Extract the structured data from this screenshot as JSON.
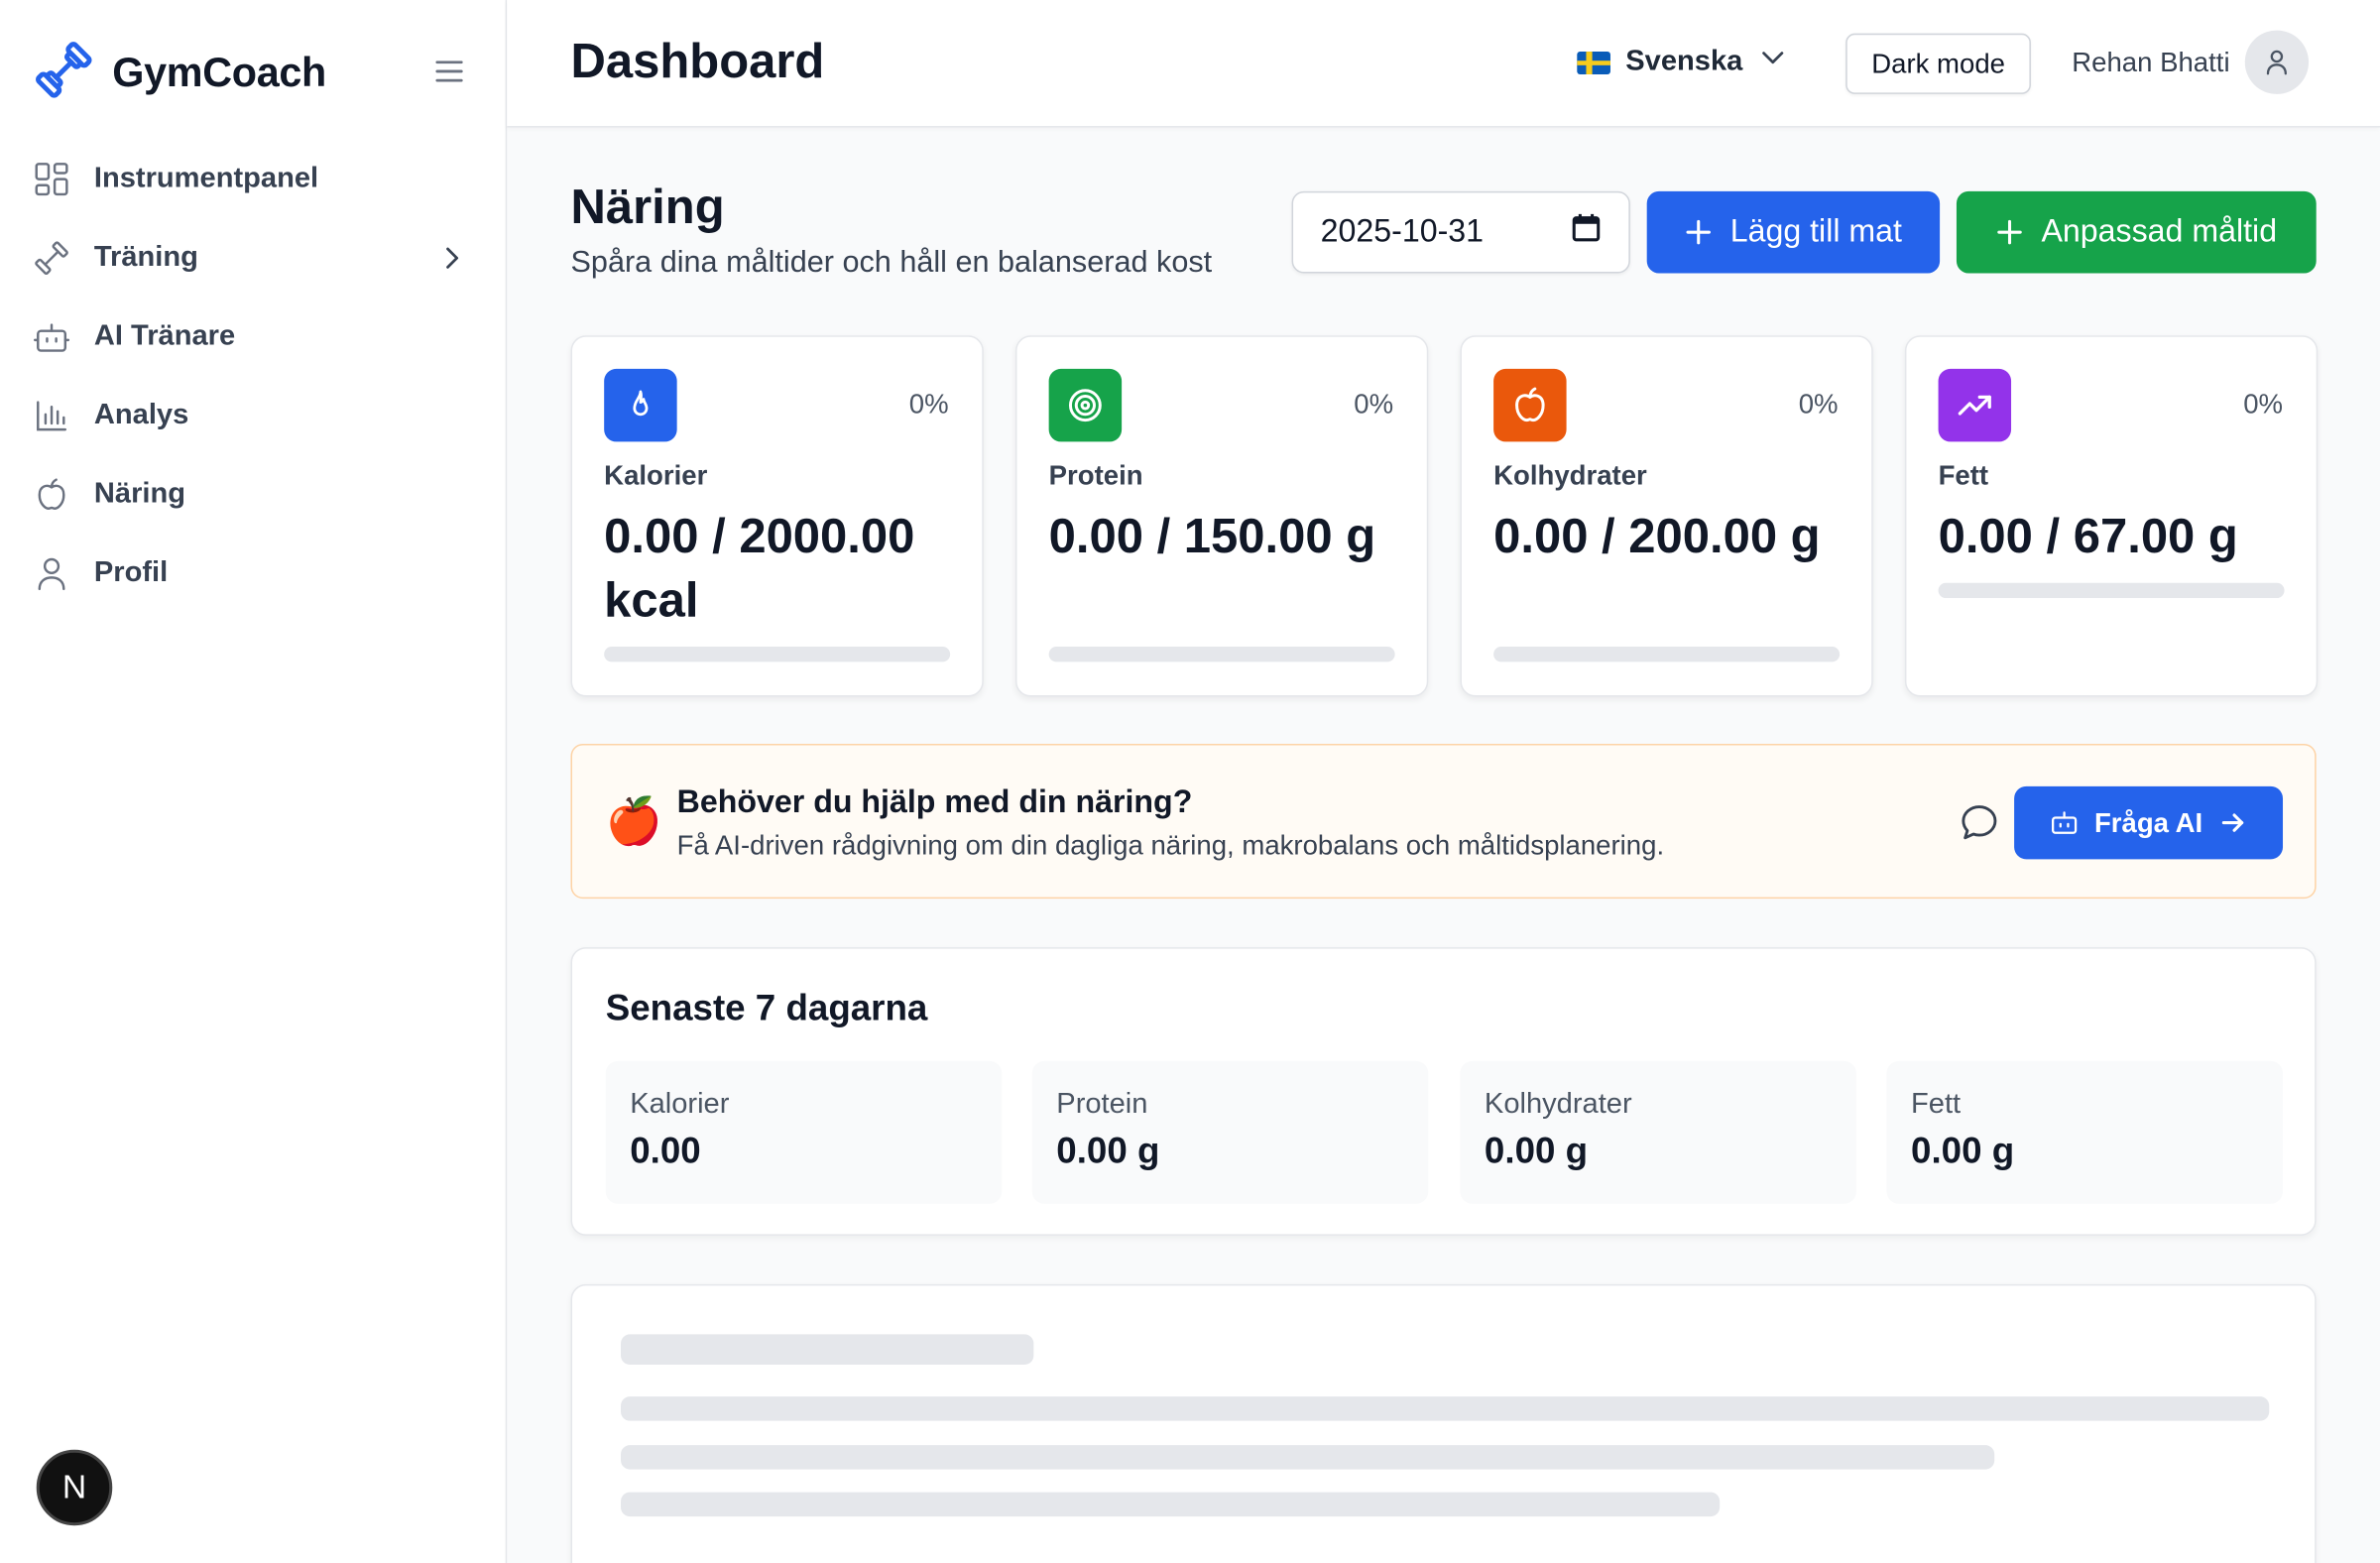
{
  "app": {
    "name": "GymCoach"
  },
  "sidebar": {
    "items": [
      {
        "label": "Instrumentpanel",
        "icon": "dashboard-grid-icon"
      },
      {
        "label": "Träning",
        "icon": "dumbbell-icon",
        "has_submenu": true
      },
      {
        "label": "AI Tränare",
        "icon": "robot-icon"
      },
      {
        "label": "Analys",
        "icon": "bar-chart-icon"
      },
      {
        "label": "Näring",
        "icon": "apple-icon"
      },
      {
        "label": "Profil",
        "icon": "user-icon"
      }
    ],
    "bottom_badge": "N"
  },
  "header": {
    "title": "Dashboard",
    "language": "Svenska",
    "dark_mode_label": "Dark mode",
    "user_name": "Rehan Bhatti"
  },
  "nutrition": {
    "title": "Näring",
    "subtitle": "Spåra dina måltider och håll en balanserad kost",
    "date": "2025-10-31",
    "add_food_label": "Lägg till mat",
    "custom_meal_label": "Anpassad måltid",
    "cards": [
      {
        "label": "Kalorier",
        "value": "0.00 / 2000.00 kcal",
        "percent": "0%",
        "progress": 0,
        "color": "#2563eb",
        "icon": "flame-icon"
      },
      {
        "label": "Protein",
        "value": "0.00 / 150.00 g",
        "percent": "0%",
        "progress": 0,
        "color": "#16a34a",
        "icon": "target-icon"
      },
      {
        "label": "Kolhydrater",
        "value": "0.00 / 200.00 g",
        "percent": "0%",
        "progress": 0,
        "color": "#ea580c",
        "icon": "apple-icon"
      },
      {
        "label": "Fett",
        "value": "0.00 / 67.00 g",
        "percent": "0%",
        "progress": 0,
        "color": "#9333ea",
        "icon": "trending-up-icon"
      }
    ],
    "help": {
      "title": "Behöver du hjälp med din näring?",
      "subtitle": "Få AI-driven rådgivning om din dagliga näring, makrobalans och måltidsplanering.",
      "button_label": "Fråga AI"
    },
    "week": {
      "title": "Senaste 7 dagarna",
      "stats": [
        {
          "label": "Kalorier",
          "value": "0.00"
        },
        {
          "label": "Protein",
          "value": "0.00 g"
        },
        {
          "label": "Kolhydrater",
          "value": "0.00 g"
        },
        {
          "label": "Fett",
          "value": "0.00 g"
        }
      ]
    }
  }
}
